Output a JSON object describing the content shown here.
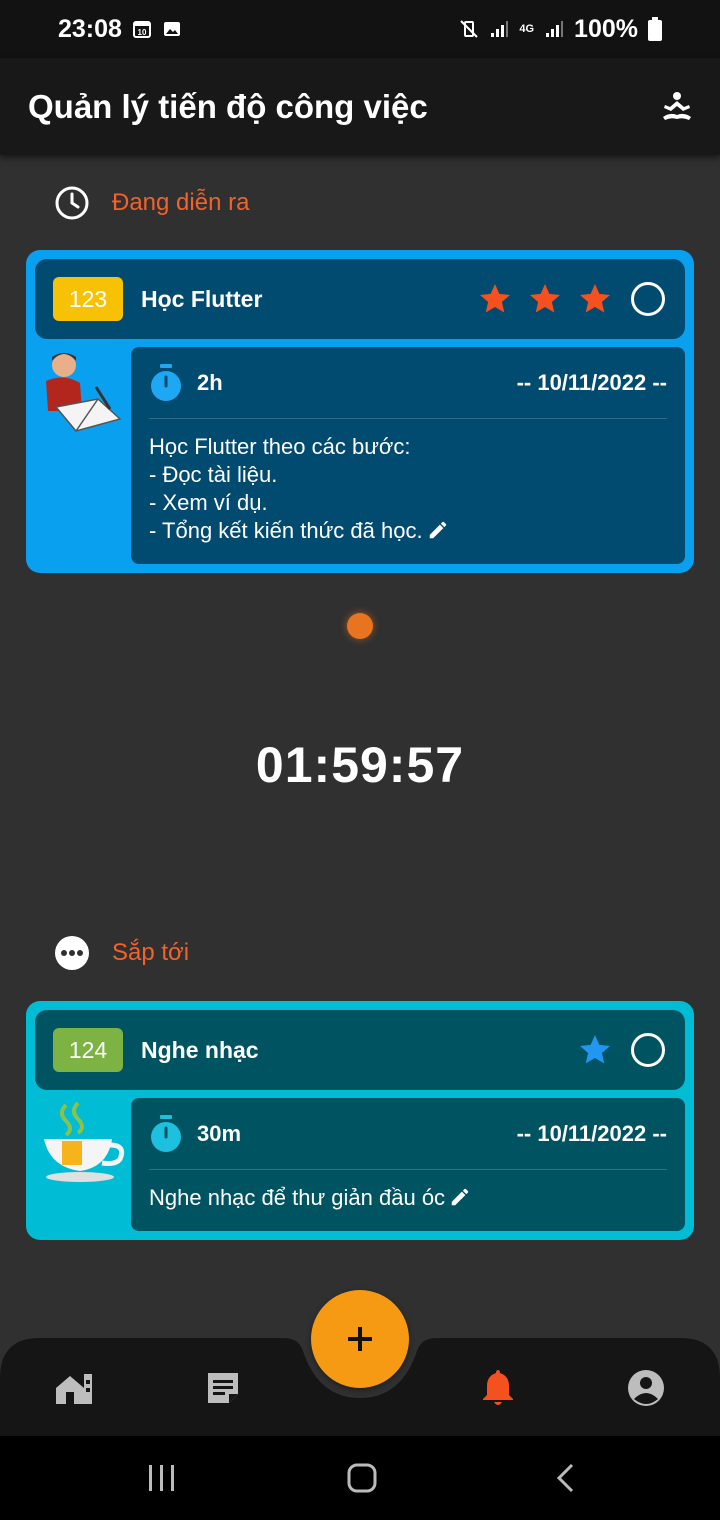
{
  "status_bar": {
    "time": "23:08",
    "calendar_day": "10",
    "network": "4G",
    "battery": "100%"
  },
  "app_bar": {
    "title": "Quản lý tiến độ công việc",
    "action_icon": "meditation-icon"
  },
  "sections": {
    "ongoing": {
      "label": "Đang diễn ra",
      "icon": "clock-icon"
    },
    "upcoming": {
      "label": "Sắp tới",
      "icon": "more-dots-icon"
    }
  },
  "tasks": [
    {
      "id": "123",
      "title": "Học Flutter",
      "stars": 3,
      "duration": "2h",
      "date": "-- 10/11/2022 --",
      "description": "Học Flutter theo các bước:\n- Đọc tài liệu.\n- Xem ví dụ.\n- Tổng kết kiến thức đã học.",
      "icon": "reading-person-icon",
      "colors": {
        "border": "#0aa0f0",
        "inner": "#024b70",
        "badge": "#f7c106",
        "star": "#f4511e"
      }
    },
    {
      "id": "124",
      "title": "Nghe nhạc",
      "stars": 1,
      "duration": "30m",
      "date": "-- 10/11/2022 --",
      "description": "Nghe nhạc để thư giản đầu óc",
      "icon": "tea-cup-icon",
      "colors": {
        "border": "#00bcd4",
        "inner": "#005461",
        "badge": "#7cb342",
        "star": "#2196f3"
      }
    }
  ],
  "timer": "01:59:57",
  "bottom_nav": {
    "items": [
      "home-icon",
      "notes-icon",
      "bell-icon",
      "account-icon"
    ],
    "active_index": 2,
    "fab_label": "+",
    "active_color": "#f4511e",
    "inactive_color": "#bdbdbd"
  }
}
